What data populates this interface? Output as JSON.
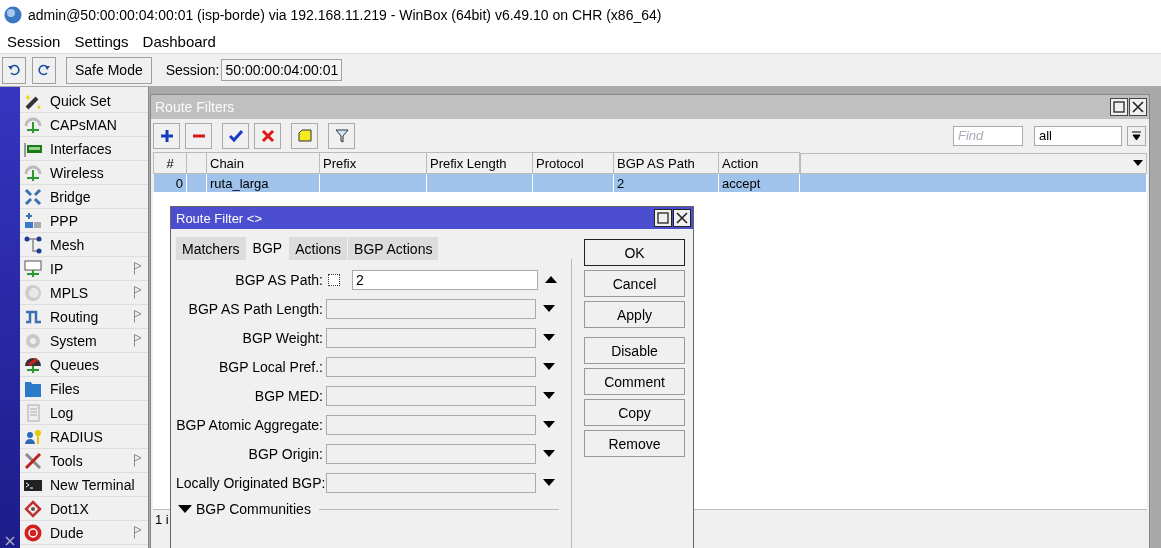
{
  "window": {
    "title": "admin@50:00:00:04:00:01 (isp-borde) via 192.168.11.219 - WinBox (64bit) v6.49.10 on CHR (x86_64)"
  },
  "menu": [
    "Session",
    "Settings",
    "Dashboard"
  ],
  "toolbar": {
    "safe_mode": "Safe Mode",
    "session_label": "Session:",
    "session_value": "50:00:00:04:00:01"
  },
  "sidebar": {
    "items": [
      {
        "label": "Quick Set",
        "submenu": false
      },
      {
        "label": "CAPsMAN",
        "submenu": false
      },
      {
        "label": "Interfaces",
        "submenu": false
      },
      {
        "label": "Wireless",
        "submenu": false
      },
      {
        "label": "Bridge",
        "submenu": false
      },
      {
        "label": "PPP",
        "submenu": false
      },
      {
        "label": "Mesh",
        "submenu": false
      },
      {
        "label": "IP",
        "submenu": true
      },
      {
        "label": "MPLS",
        "submenu": true
      },
      {
        "label": "Routing",
        "submenu": true
      },
      {
        "label": "System",
        "submenu": true
      },
      {
        "label": "Queues",
        "submenu": false
      },
      {
        "label": "Files",
        "submenu": false
      },
      {
        "label": "Log",
        "submenu": false
      },
      {
        "label": "RADIUS",
        "submenu": false
      },
      {
        "label": "Tools",
        "submenu": true
      },
      {
        "label": "New Terminal",
        "submenu": false
      },
      {
        "label": "Dot1X",
        "submenu": false
      },
      {
        "label": "Dude",
        "submenu": true
      }
    ]
  },
  "route_filters": {
    "title": "Route Filters",
    "find": {
      "placeholder": "Find"
    },
    "filter": {
      "value": "all"
    },
    "table": {
      "columns": [
        "#",
        "",
        "Chain",
        "Prefix",
        "Prefix Length",
        "Protocol",
        "BGP AS Path",
        "Action"
      ],
      "rows": [
        {
          "cells": [
            "0",
            "",
            "ruta_larga",
            "",
            "",
            "",
            "2",
            "accept"
          ],
          "selected": true
        }
      ]
    },
    "status": "1 i"
  },
  "dialog": {
    "title": "Route Filter <>",
    "tabs": [
      {
        "label": "Matchers",
        "selected": false
      },
      {
        "label": "BGP",
        "selected": true
      },
      {
        "label": "Actions",
        "selected": false
      },
      {
        "label": "BGP Actions",
        "selected": false
      }
    ],
    "fields": [
      {
        "label": "BGP AS Path:",
        "kind": "set",
        "value": "2",
        "negated": false
      },
      {
        "label": "BGP AS Path Length:",
        "kind": "unset"
      },
      {
        "label": "BGP Weight:",
        "kind": "unset"
      },
      {
        "label": "BGP Local Pref.:",
        "kind": "unset"
      },
      {
        "label": "BGP MED:",
        "kind": "unset"
      },
      {
        "label": "BGP Atomic Aggregate:",
        "kind": "unset"
      },
      {
        "label": "BGP Origin:",
        "kind": "unset"
      },
      {
        "label": "Locally Originated BGP:",
        "kind": "unset"
      }
    ],
    "section": "BGP Communities",
    "buttons": [
      {
        "label": "OK",
        "default": true
      },
      {
        "label": "Cancel",
        "default": false
      },
      {
        "label": "Apply",
        "default": false
      },
      {
        "label": "Disable",
        "default": false
      },
      {
        "label": "Comment",
        "default": false
      },
      {
        "label": "Copy",
        "default": false
      },
      {
        "label": "Remove",
        "default": false
      }
    ]
  }
}
